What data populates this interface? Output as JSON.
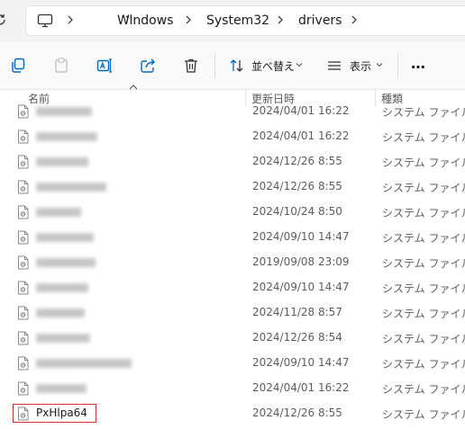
{
  "address_bar": {
    "breadcrumbs": [
      "Windows",
      "System32",
      "drivers"
    ],
    "overflow_label": "⋯"
  },
  "toolbar": {
    "sort_label": "並べ替え",
    "view_label": "表示",
    "more_label": "⋯"
  },
  "columns": {
    "name": "名前",
    "modified": "更新日時",
    "type": "種類"
  },
  "files": [
    {
      "name": "",
      "modified": "2024/04/01 16:22",
      "type": "システム ファイル"
    },
    {
      "name": "",
      "modified": "2024/04/01 16:22",
      "type": "システム ファイル"
    },
    {
      "name": "",
      "modified": "2024/12/26 8:55",
      "type": "システム ファイル"
    },
    {
      "name": "",
      "modified": "2024/12/26 8:55",
      "type": "システム ファイル"
    },
    {
      "name": "",
      "modified": "2024/10/24 8:50",
      "type": "システム ファイル"
    },
    {
      "name": "",
      "modified": "2024/09/10 14:47",
      "type": "システム ファイル"
    },
    {
      "name": "",
      "modified": "2019/09/08 23:09",
      "type": "システム ファイル"
    },
    {
      "name": "",
      "modified": "2024/09/10 14:47",
      "type": "システム ファイル"
    },
    {
      "name": "",
      "modified": "2024/11/28 8:57",
      "type": "システム ファイル"
    },
    {
      "name": "",
      "modified": "2024/12/26 8:54",
      "type": "システム ファイル"
    },
    {
      "name": "",
      "modified": "2024/09/10 14:47",
      "type": "システム ファイル"
    },
    {
      "name": "",
      "modified": "2024/04/01 16:22",
      "type": "システム ファイル"
    },
    {
      "name": "PxHlpa64",
      "modified": "2024/12/26 8:55",
      "type": "システム ファイル"
    }
  ],
  "icons": {
    "refresh": "refresh-icon",
    "pc": "this-pc-icon",
    "copy": "copy-icon",
    "paste": "paste-icon",
    "rename": "rename-icon",
    "share": "share-icon",
    "delete": "delete-icon",
    "sort": "sort-icon",
    "view": "view-icon",
    "file": "system-file-icon"
  },
  "colors": {
    "highlight": "#d9302f",
    "accent": "#0067c0"
  }
}
